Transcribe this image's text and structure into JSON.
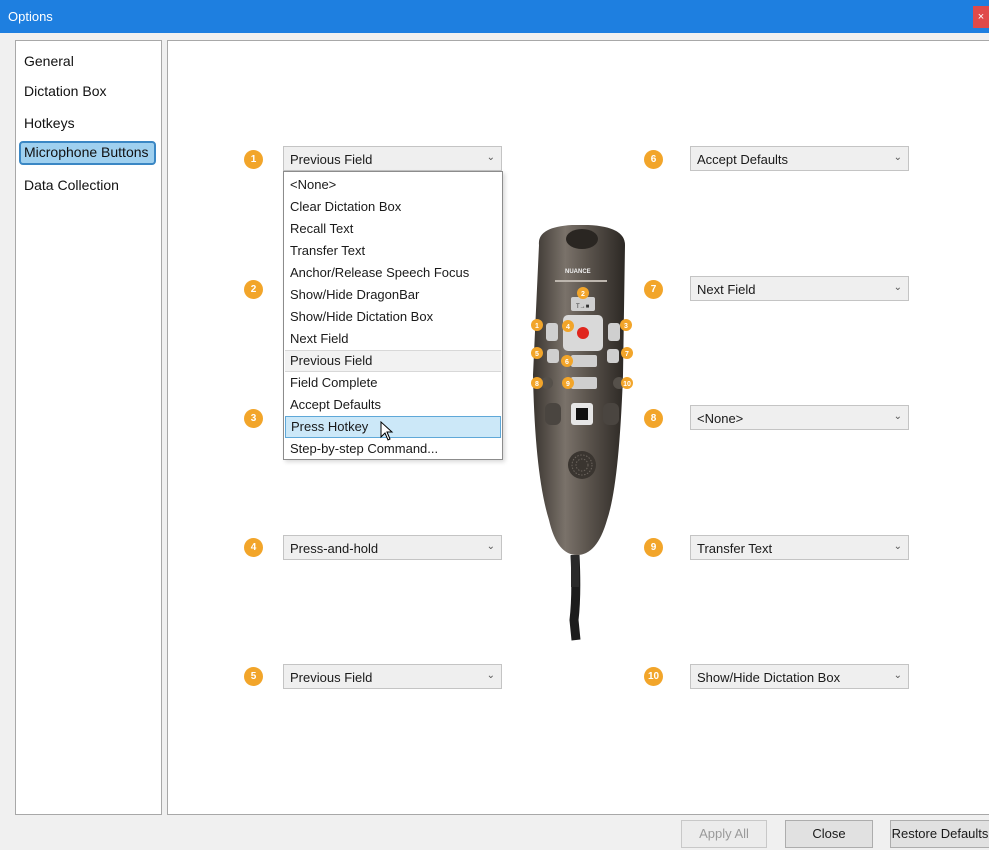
{
  "window": {
    "title": "Options",
    "close_glyph": "×"
  },
  "sidebar": {
    "items": [
      {
        "label": "General"
      },
      {
        "label": "Dictation Box"
      },
      {
        "label": "Hotkeys"
      },
      {
        "label": "Microphone Buttons",
        "selected": true
      },
      {
        "label": "Data Collection"
      }
    ]
  },
  "buttons": [
    {
      "number": "1",
      "value": "Previous Field"
    },
    {
      "number": "2",
      "value": ""
    },
    {
      "number": "3",
      "value": ""
    },
    {
      "number": "4",
      "value": "Press-and-hold"
    },
    {
      "number": "5",
      "value": "Previous Field"
    },
    {
      "number": "6",
      "value": "Accept Defaults"
    },
    {
      "number": "7",
      "value": "Next Field"
    },
    {
      "number": "8",
      "value": "<None>"
    },
    {
      "number": "9",
      "value": "Transfer Text"
    },
    {
      "number": "10",
      "value": "Show/Hide Dictation Box"
    }
  ],
  "dropdown": {
    "options": [
      "<None>",
      "Clear Dictation Box",
      "Recall Text",
      "Transfer Text",
      "Anchor/Release Speech Focus",
      "Show/Hide DragonBar",
      "Show/Hide Dictation Box",
      "Next Field",
      "Previous Field",
      "Field Complete",
      "Accept Defaults",
      "Press Hotkey",
      "Step-by-step Command..."
    ],
    "current": "Previous Field",
    "hovered": "Press Hotkey"
  },
  "device": {
    "brand": "NUANCE",
    "key_labels": [
      "1",
      "2",
      "3",
      "4",
      "5",
      "6",
      "7",
      "8",
      "9",
      "10"
    ],
    "top_key_text": "T→■"
  },
  "footer": {
    "apply_all": "Apply All",
    "close": "Close",
    "restore_defaults": "Restore Defaults"
  },
  "colors": {
    "titlebar": "#1e7fe0",
    "badge": "#f2a52a",
    "selection": "#9fd0ef",
    "hover": "#cce8f8"
  }
}
